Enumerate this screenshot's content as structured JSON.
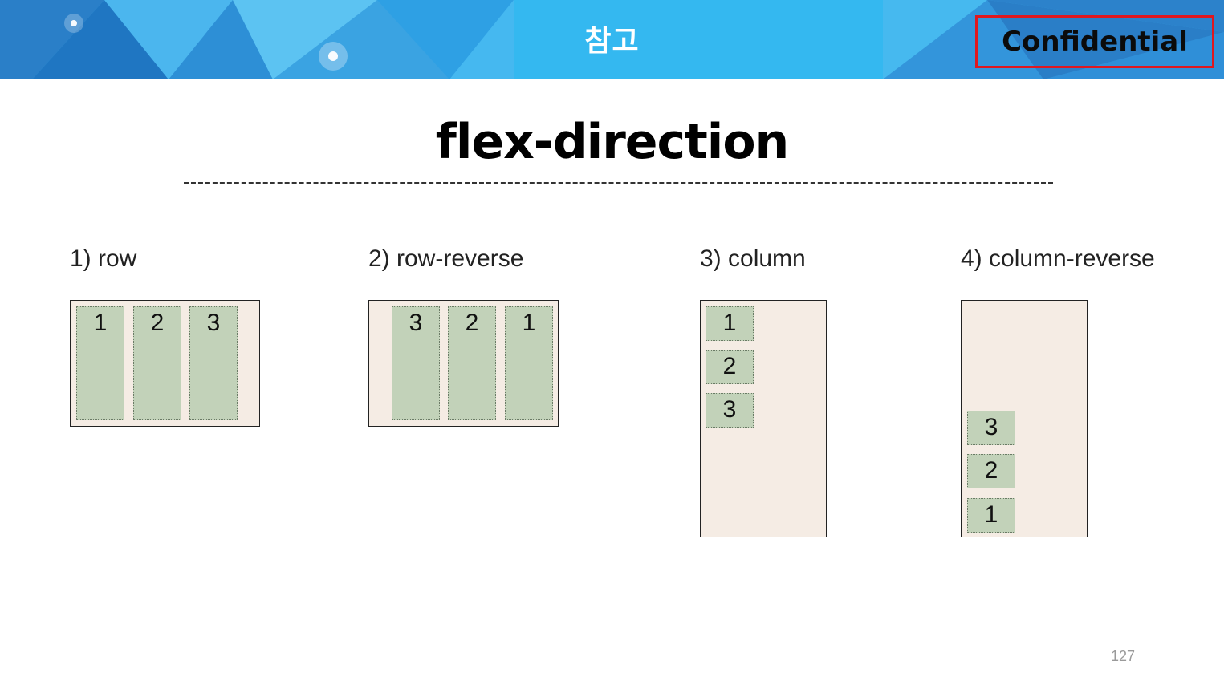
{
  "header": {
    "title": "참고",
    "badge": "Confidential",
    "badge_border_color": "#e0171f"
  },
  "slide": {
    "title": "flex-direction",
    "page_number": "127"
  },
  "examples": [
    {
      "label": "1) row",
      "items": [
        "1",
        "2",
        "3"
      ]
    },
    {
      "label": "2) row-reverse",
      "items": [
        "3",
        "2",
        "1"
      ]
    },
    {
      "label": "3) column",
      "items": [
        "1",
        "2",
        "3"
      ]
    },
    {
      "label": "4) column-reverse",
      "items": [
        "3",
        "2",
        "1"
      ]
    }
  ],
  "colors": {
    "container_bg": "#f5ece4",
    "item_bg": "#c2d2b9",
    "header_blue": "#2f9fe0"
  }
}
